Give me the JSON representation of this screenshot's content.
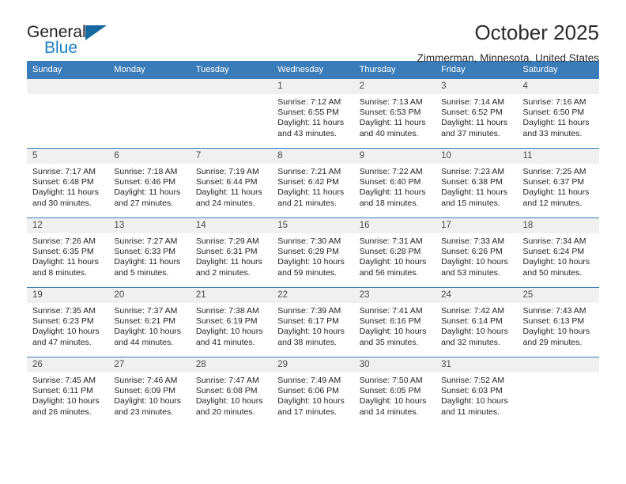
{
  "brand": {
    "name_part1": "General",
    "name_part2": "Blue",
    "accent_color": "#1b7fc4",
    "logo_icon": "blue-triangle-icon"
  },
  "header": {
    "title": "October 2025",
    "location": "Zimmerman, Minnesota, United States"
  },
  "calendar": {
    "header_bg": "#3a7cba",
    "daynum_bg": "#f0f0f0",
    "weekday_labels": [
      "Sunday",
      "Monday",
      "Tuesday",
      "Wednesday",
      "Thursday",
      "Friday",
      "Saturday"
    ],
    "weeks": [
      [
        {
          "day": "",
          "sunrise": "",
          "sunset": "",
          "daylight_line1": "",
          "daylight_line2": ""
        },
        {
          "day": "",
          "sunrise": "",
          "sunset": "",
          "daylight_line1": "",
          "daylight_line2": ""
        },
        {
          "day": "",
          "sunrise": "",
          "sunset": "",
          "daylight_line1": "",
          "daylight_line2": ""
        },
        {
          "day": "1",
          "sunrise": "Sunrise: 7:12 AM",
          "sunset": "Sunset: 6:55 PM",
          "daylight_line1": "Daylight: 11 hours",
          "daylight_line2": "and 43 minutes."
        },
        {
          "day": "2",
          "sunrise": "Sunrise: 7:13 AM",
          "sunset": "Sunset: 6:53 PM",
          "daylight_line1": "Daylight: 11 hours",
          "daylight_line2": "and 40 minutes."
        },
        {
          "day": "3",
          "sunrise": "Sunrise: 7:14 AM",
          "sunset": "Sunset: 6:52 PM",
          "daylight_line1": "Daylight: 11 hours",
          "daylight_line2": "and 37 minutes."
        },
        {
          "day": "4",
          "sunrise": "Sunrise: 7:16 AM",
          "sunset": "Sunset: 6:50 PM",
          "daylight_line1": "Daylight: 11 hours",
          "daylight_line2": "and 33 minutes."
        }
      ],
      [
        {
          "day": "5",
          "sunrise": "Sunrise: 7:17 AM",
          "sunset": "Sunset: 6:48 PM",
          "daylight_line1": "Daylight: 11 hours",
          "daylight_line2": "and 30 minutes."
        },
        {
          "day": "6",
          "sunrise": "Sunrise: 7:18 AM",
          "sunset": "Sunset: 6:46 PM",
          "daylight_line1": "Daylight: 11 hours",
          "daylight_line2": "and 27 minutes."
        },
        {
          "day": "7",
          "sunrise": "Sunrise: 7:19 AM",
          "sunset": "Sunset: 6:44 PM",
          "daylight_line1": "Daylight: 11 hours",
          "daylight_line2": "and 24 minutes."
        },
        {
          "day": "8",
          "sunrise": "Sunrise: 7:21 AM",
          "sunset": "Sunset: 6:42 PM",
          "daylight_line1": "Daylight: 11 hours",
          "daylight_line2": "and 21 minutes."
        },
        {
          "day": "9",
          "sunrise": "Sunrise: 7:22 AM",
          "sunset": "Sunset: 6:40 PM",
          "daylight_line1": "Daylight: 11 hours",
          "daylight_line2": "and 18 minutes."
        },
        {
          "day": "10",
          "sunrise": "Sunrise: 7:23 AM",
          "sunset": "Sunset: 6:38 PM",
          "daylight_line1": "Daylight: 11 hours",
          "daylight_line2": "and 15 minutes."
        },
        {
          "day": "11",
          "sunrise": "Sunrise: 7:25 AM",
          "sunset": "Sunset: 6:37 PM",
          "daylight_line1": "Daylight: 11 hours",
          "daylight_line2": "and 12 minutes."
        }
      ],
      [
        {
          "day": "12",
          "sunrise": "Sunrise: 7:26 AM",
          "sunset": "Sunset: 6:35 PM",
          "daylight_line1": "Daylight: 11 hours",
          "daylight_line2": "and 8 minutes."
        },
        {
          "day": "13",
          "sunrise": "Sunrise: 7:27 AM",
          "sunset": "Sunset: 6:33 PM",
          "daylight_line1": "Daylight: 11 hours",
          "daylight_line2": "and 5 minutes."
        },
        {
          "day": "14",
          "sunrise": "Sunrise: 7:29 AM",
          "sunset": "Sunset: 6:31 PM",
          "daylight_line1": "Daylight: 11 hours",
          "daylight_line2": "and 2 minutes."
        },
        {
          "day": "15",
          "sunrise": "Sunrise: 7:30 AM",
          "sunset": "Sunset: 6:29 PM",
          "daylight_line1": "Daylight: 10 hours",
          "daylight_line2": "and 59 minutes."
        },
        {
          "day": "16",
          "sunrise": "Sunrise: 7:31 AM",
          "sunset": "Sunset: 6:28 PM",
          "daylight_line1": "Daylight: 10 hours",
          "daylight_line2": "and 56 minutes."
        },
        {
          "day": "17",
          "sunrise": "Sunrise: 7:33 AM",
          "sunset": "Sunset: 6:26 PM",
          "daylight_line1": "Daylight: 10 hours",
          "daylight_line2": "and 53 minutes."
        },
        {
          "day": "18",
          "sunrise": "Sunrise: 7:34 AM",
          "sunset": "Sunset: 6:24 PM",
          "daylight_line1": "Daylight: 10 hours",
          "daylight_line2": "and 50 minutes."
        }
      ],
      [
        {
          "day": "19",
          "sunrise": "Sunrise: 7:35 AM",
          "sunset": "Sunset: 6:23 PM",
          "daylight_line1": "Daylight: 10 hours",
          "daylight_line2": "and 47 minutes."
        },
        {
          "day": "20",
          "sunrise": "Sunrise: 7:37 AM",
          "sunset": "Sunset: 6:21 PM",
          "daylight_line1": "Daylight: 10 hours",
          "daylight_line2": "and 44 minutes."
        },
        {
          "day": "21",
          "sunrise": "Sunrise: 7:38 AM",
          "sunset": "Sunset: 6:19 PM",
          "daylight_line1": "Daylight: 10 hours",
          "daylight_line2": "and 41 minutes."
        },
        {
          "day": "22",
          "sunrise": "Sunrise: 7:39 AM",
          "sunset": "Sunset: 6:17 PM",
          "daylight_line1": "Daylight: 10 hours",
          "daylight_line2": "and 38 minutes."
        },
        {
          "day": "23",
          "sunrise": "Sunrise: 7:41 AM",
          "sunset": "Sunset: 6:16 PM",
          "daylight_line1": "Daylight: 10 hours",
          "daylight_line2": "and 35 minutes."
        },
        {
          "day": "24",
          "sunrise": "Sunrise: 7:42 AM",
          "sunset": "Sunset: 6:14 PM",
          "daylight_line1": "Daylight: 10 hours",
          "daylight_line2": "and 32 minutes."
        },
        {
          "day": "25",
          "sunrise": "Sunrise: 7:43 AM",
          "sunset": "Sunset: 6:13 PM",
          "daylight_line1": "Daylight: 10 hours",
          "daylight_line2": "and 29 minutes."
        }
      ],
      [
        {
          "day": "26",
          "sunrise": "Sunrise: 7:45 AM",
          "sunset": "Sunset: 6:11 PM",
          "daylight_line1": "Daylight: 10 hours",
          "daylight_line2": "and 26 minutes."
        },
        {
          "day": "27",
          "sunrise": "Sunrise: 7:46 AM",
          "sunset": "Sunset: 6:09 PM",
          "daylight_line1": "Daylight: 10 hours",
          "daylight_line2": "and 23 minutes."
        },
        {
          "day": "28",
          "sunrise": "Sunrise: 7:47 AM",
          "sunset": "Sunset: 6:08 PM",
          "daylight_line1": "Daylight: 10 hours",
          "daylight_line2": "and 20 minutes."
        },
        {
          "day": "29",
          "sunrise": "Sunrise: 7:49 AM",
          "sunset": "Sunset: 6:06 PM",
          "daylight_line1": "Daylight: 10 hours",
          "daylight_line2": "and 17 minutes."
        },
        {
          "day": "30",
          "sunrise": "Sunrise: 7:50 AM",
          "sunset": "Sunset: 6:05 PM",
          "daylight_line1": "Daylight: 10 hours",
          "daylight_line2": "and 14 minutes."
        },
        {
          "day": "31",
          "sunrise": "Sunrise: 7:52 AM",
          "sunset": "Sunset: 6:03 PM",
          "daylight_line1": "Daylight: 10 hours",
          "daylight_line2": "and 11 minutes."
        },
        {
          "day": "",
          "sunrise": "",
          "sunset": "",
          "daylight_line1": "",
          "daylight_line2": ""
        }
      ]
    ]
  }
}
